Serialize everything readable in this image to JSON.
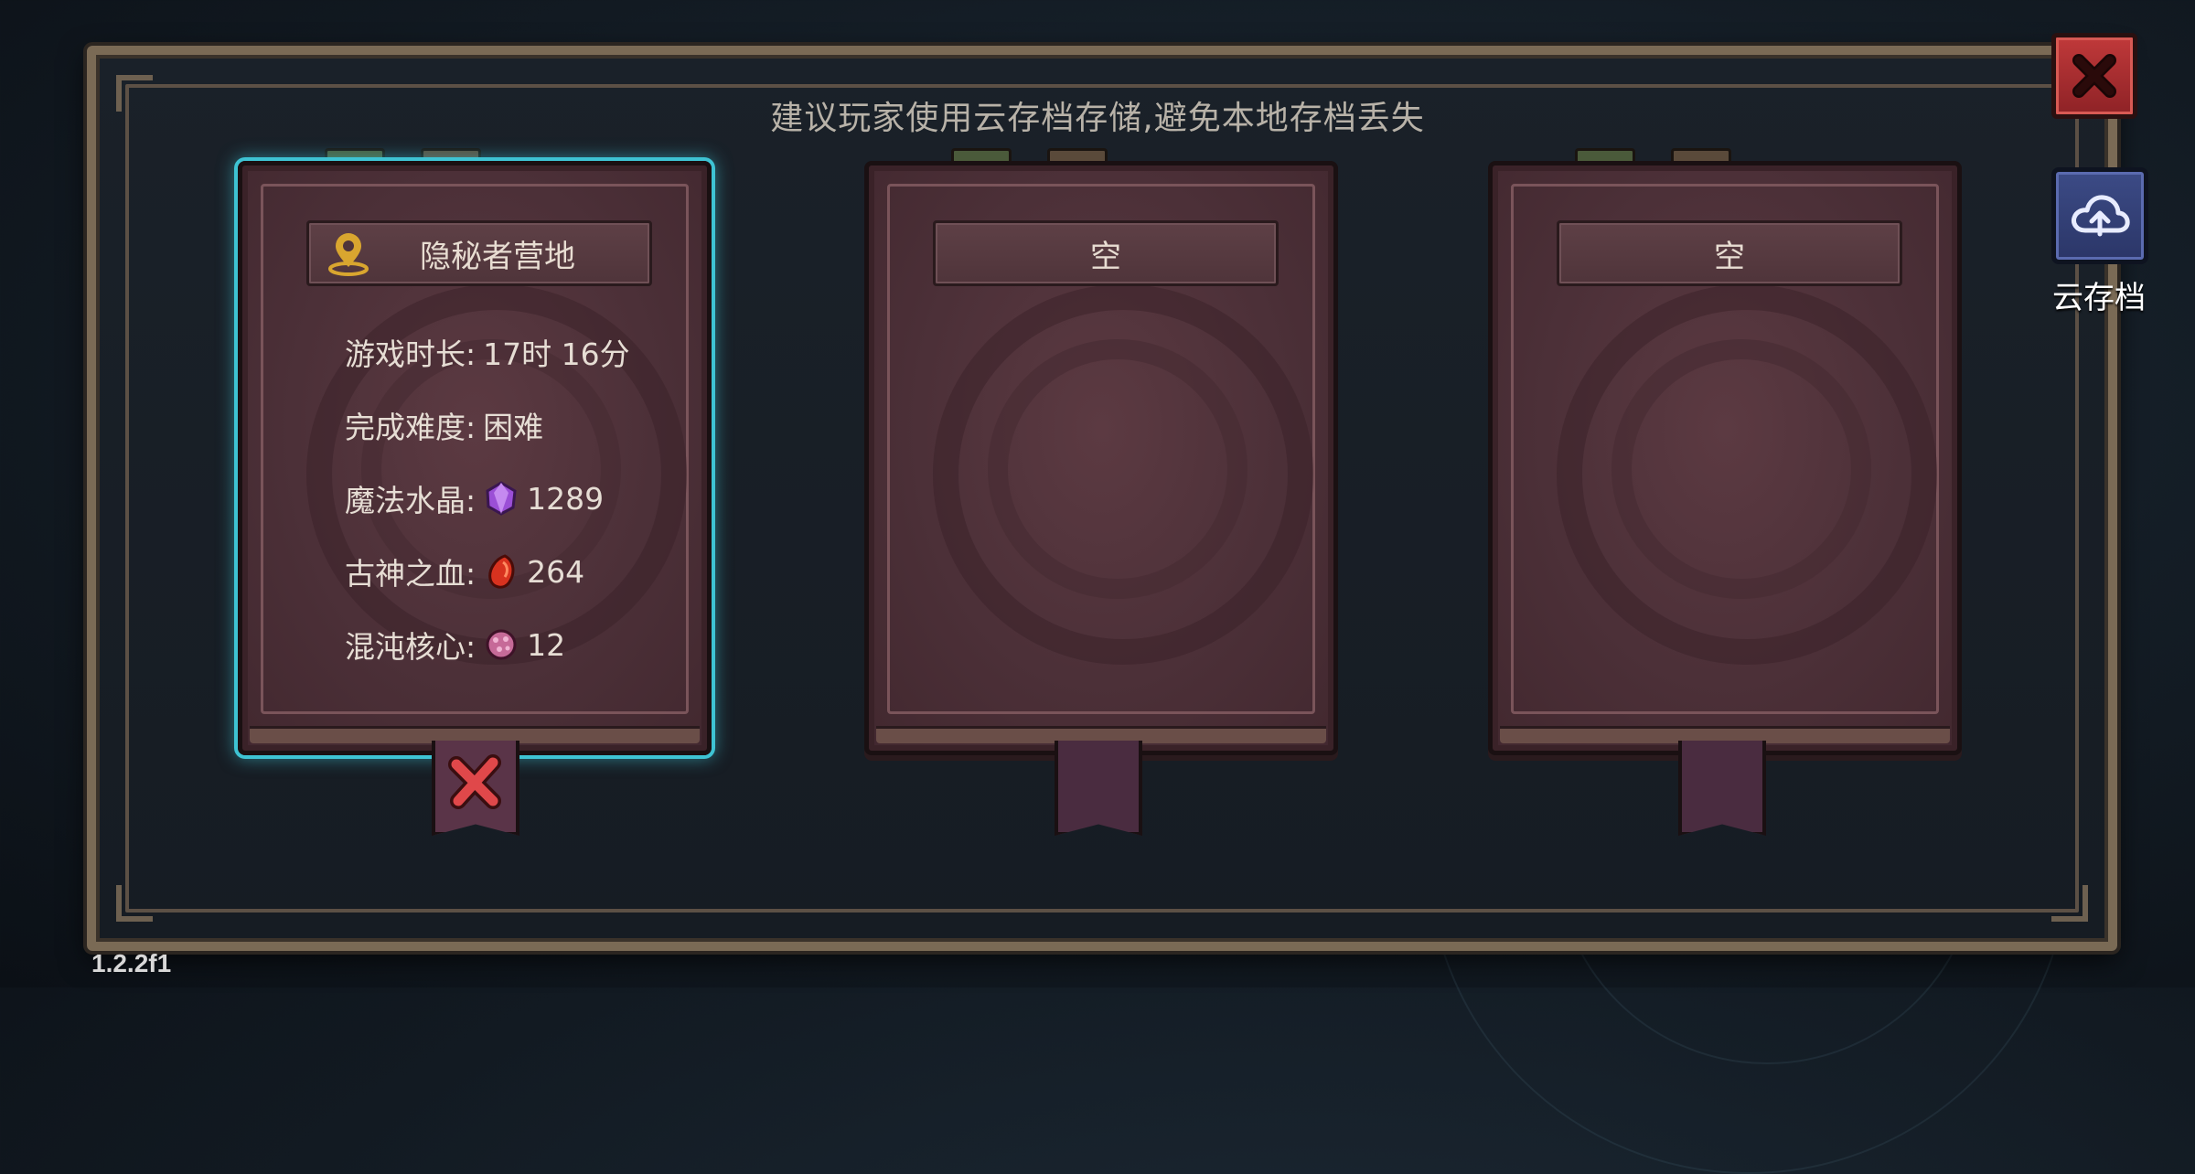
{
  "hint": "建议玩家使用云存档存储,避免本地存档丢失",
  "slots": [
    {
      "title": "隐秘者营地",
      "selected": true,
      "icon": "location-pin-icon",
      "stats": [
        {
          "label": "游戏时长:",
          "value": "17时 16分"
        },
        {
          "label": "完成难度:",
          "value": "困难"
        },
        {
          "label": "魔法水晶:",
          "value": "1289",
          "icon": "purple-crystal-icon"
        },
        {
          "label": "古神之血:",
          "value": "264",
          "icon": "red-blood-gem-icon"
        },
        {
          "label": "混沌核心:",
          "value": "12",
          "icon": "chaos-core-icon"
        }
      ]
    },
    {
      "title": "空",
      "selected": false
    },
    {
      "title": "空",
      "selected": false
    }
  ],
  "cloud_save_label": "云存档",
  "version": "1.2.2f1",
  "colors": {
    "selected_glow": "#3ec3d3",
    "close_red": "#c0393a",
    "cloud_blue": "#3c4b86",
    "book": "#4c3038"
  }
}
